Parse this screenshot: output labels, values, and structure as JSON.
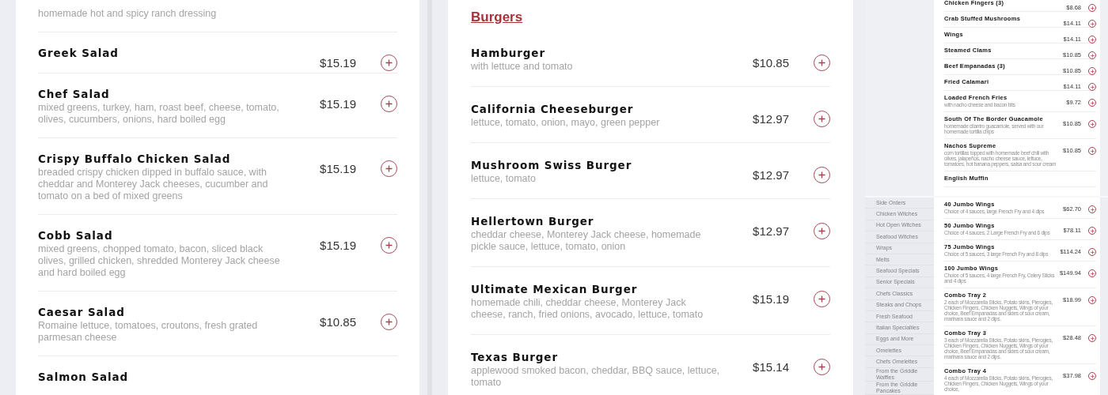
{
  "salads": {
    "items": [
      {
        "description": "homemade hot and spicy ranch dressing"
      },
      {
        "name": "Greek Salad",
        "price": "$15.19"
      },
      {
        "name": "Chef Salad",
        "description": "mixed greens, turkey, ham, roast beef, cheese, tomato, olives, cucumbers, onions, hard boiled egg",
        "price": "$15.19"
      },
      {
        "name": "Crispy Buffalo Chicken Salad",
        "description": "breaded crispy chicken dipped in buffalo sauce, with cheddar and Monterey Jack cheeses, cucumber and tomato on a bed of mixed greens",
        "price": "$15.19"
      },
      {
        "name": "Cobb Salad",
        "description": "mixed greens, chopped tomato, bacon, sliced black olives, grilled chicken, shredded Monterey Jack cheese and hard boiled egg",
        "price": "$15.19"
      },
      {
        "name": "Caesar Salad",
        "description": "Romaine lettuce, tomatoes, croutons, fresh grated parmesan cheese",
        "price": "$10.85"
      },
      {
        "name": "Salmon Salad"
      }
    ]
  },
  "burgers": {
    "heading": "Burgers",
    "items": [
      {
        "name": "Hamburger",
        "description": "with lettuce and tomato",
        "price": "$10.85"
      },
      {
        "name": "California Cheeseburger",
        "description": "lettuce, tomato, onion, mayo, green pepper",
        "price": "$12.97"
      },
      {
        "name": "Mushroom Swiss Burger",
        "description": "lettuce, tomato",
        "price": "$12.97"
      },
      {
        "name": "Hellertown Burger",
        "description": "cheddar cheese, Monterey Jack cheese, homemade pickle sauce, lettuce, tomato, onion",
        "price": "$12.97"
      },
      {
        "name": "Ultimate Mexican Burger",
        "description": "homemade chili, cheddar cheese, Monterey Jack cheese, ranch, fried onions, avocado, lettuce, tomato",
        "price": "$15.19"
      },
      {
        "name": "Texas Burger",
        "description": "applewood smoked bacon, cheddar, BBQ sauce, lettuce, tomato",
        "price": "$15.14"
      }
    ]
  },
  "appetizers_preview": {
    "items": [
      {
        "name": "Chicken Fingers (3)",
        "price": "$8.68"
      },
      {
        "name": "Crab Stuffed Mushrooms",
        "price": "$14.11"
      },
      {
        "name": "Wings",
        "price": "$14.11"
      },
      {
        "name": "Steamed Clams",
        "price": "$10.85"
      },
      {
        "name": "Beef Empanadas (3)",
        "price": "$10.85"
      },
      {
        "name": "Fried Calamari",
        "price": "$14.11"
      },
      {
        "name": "Loaded French Fries",
        "description": "with nacho cheese and bacon bits",
        "price": "$9.72"
      },
      {
        "name": "South Of The Border Guacamole",
        "description": "homemade cilantro guacamole, served with our homemade tortilla chips",
        "price": "$10.85"
      },
      {
        "name": "Nachos Supreme",
        "description": "corn tortillas topped with homemade beef chili with olives, jalapeños, nacho cheese sauce, lettuce, tomatoes, hot banana peppers, salsa and sour cream",
        "price": "$10.85"
      },
      {
        "name": "English Muffin"
      }
    ]
  },
  "wings_preview": {
    "categories": [
      "Side Orders",
      "Chicken Witches",
      "Hot Open Witches",
      "Seafood Witches",
      "Wraps",
      "Melts",
      "Seafood Specials",
      "Senior Specials",
      "Chefs Classics",
      "Steaks and Chops",
      "Fresh Seafood",
      "Italian Specialties",
      "Eggs and More",
      "Omelettes",
      "Chefs Omelettes",
      "From the Griddle Waffles",
      "From the Griddle Pancakes"
    ],
    "items": [
      {
        "name": "40 Jumbo Wings",
        "description": "Choice of 4 sauces, large French Fry and 4 dips",
        "price": "$62.70"
      },
      {
        "name": "50 Jumbo Wings",
        "description": "Choice of 4 sauces, 2 Large French Fry and 6 dips",
        "price": "$78.11"
      },
      {
        "name": "75 Jumbo Wings",
        "description": "Choice of 5 sauces, 3 large French Fry and 8 dips",
        "price": "$114.24"
      },
      {
        "name": "100 Jumbo Wings",
        "description": "Choice of 5 sauces, 4 large French Fry, Celery Sticks and 4 dips",
        "price": "$149.94"
      },
      {
        "name": "Combo Tray 2",
        "description": "2 each of Mozzarella Sticks, Potato skins, Pierogies, Chicken Fingers, Chicken Nuggets, Wings of your choice, Beef Empanadas and sides of sour cream, marinara sauce and 2 dips.",
        "price": "$18.99"
      },
      {
        "name": "Combo Tray 3",
        "description": "3 each of Mozzarella Sticks, Potato skins, Pierogies, Chicken Fingers, Chicken Nuggets, Wings of your choice, Beef Empanadas and sides of sour cream, marinara sauce and 2 dips.",
        "price": "$28.48"
      },
      {
        "name": "Combo Tray 4",
        "description": "4 each of Mozzarella Sticks, Potato skins, Pierogies, Chicken Fingers, Chicken Nuggets, Wings of your choice,",
        "price": "$37.98"
      }
    ]
  }
}
